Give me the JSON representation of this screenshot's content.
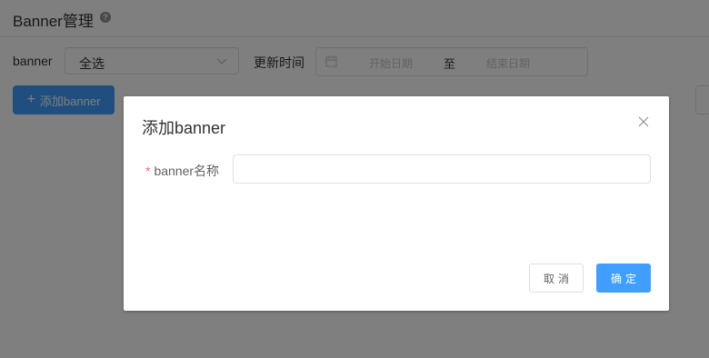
{
  "page": {
    "title": "Banner管理",
    "help_icon": "question-circle-icon",
    "filters": {
      "banner_label": "banner",
      "banner_select_value": "全选",
      "time_label": "更新时间",
      "start_placeholder": "开始日期",
      "range_separator": "至",
      "end_placeholder": "结束日期"
    },
    "add_button_label": "添加banner",
    "add_button_icon": "plus-icon"
  },
  "dialog": {
    "title": "添加banner",
    "close_icon": "close-icon",
    "field_required_mark": "*",
    "field_label": "banner名称",
    "field_value": "",
    "field_placeholder": "",
    "cancel_label": "取消",
    "confirm_label": "确定"
  },
  "colors": {
    "primary": "#409eff",
    "required": "#f56c6c",
    "overlay": "rgba(0,0,0,0.5)"
  }
}
